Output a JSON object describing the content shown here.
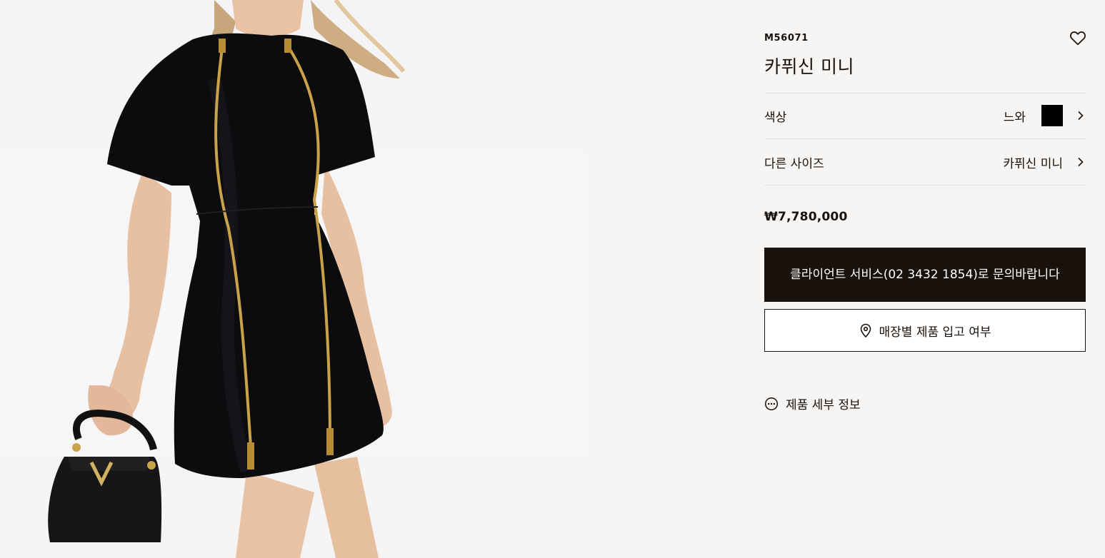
{
  "product": {
    "sku": "M56071",
    "name": "카퓌신 미니",
    "price": "₩7,780,000"
  },
  "options": {
    "color_label": "색상",
    "color_value": "느와",
    "color_swatch": "#000000",
    "size_label": "다른 사이즈",
    "size_value": "카퓌신 미니"
  },
  "actions": {
    "contact_label": "클라이언트 서비스(02 3432 1854)로 문의바랍니다",
    "store_label": "매장별 제품 입고 여부",
    "details_label": "제품 세부 정보"
  },
  "icons": {
    "wishlist": "heart-icon",
    "chevron": "chevron-right-icon",
    "location": "location-pin-icon",
    "more": "more-circle-icon"
  },
  "colors": {
    "background": "#f6f5f3",
    "primary": "#19110b",
    "divider": "#e4e2de"
  }
}
